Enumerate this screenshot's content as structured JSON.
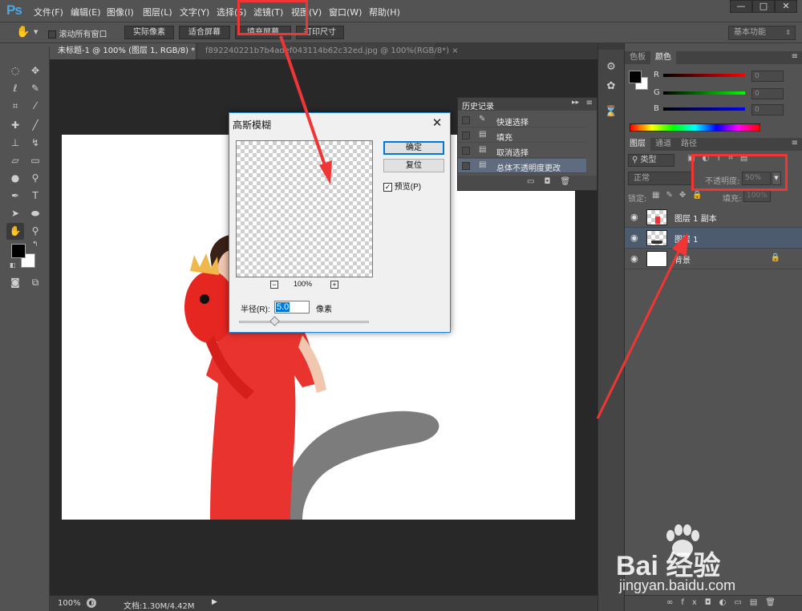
{
  "app": {
    "logo": "Ps"
  },
  "menu": [
    "文件(F)",
    "编辑(E)",
    "图像(I)",
    "图层(L)",
    "文字(Y)",
    "选择(S)",
    "滤镜(T)",
    "视图(V)",
    "窗口(W)",
    "帮助(H)"
  ],
  "window_controls": {
    "minimize": "—",
    "maximize": "□",
    "close": "✕"
  },
  "options_bar": {
    "scroll_all_label": "滚动所有窗口",
    "actual_pixels": "实际像素",
    "fit_screen": "适合屏幕",
    "fill_screen": "填充屏幕",
    "print_size": "打印尺寸",
    "workspace": "基本功能"
  },
  "tabs": [
    {
      "label": "未标题-1 @ 100% (图层 1, RGB/8) * ×"
    },
    {
      "label": "f892240221b7b4adef043114b62c32ed.jpg @ 100%(RGB/8*) ×"
    }
  ],
  "status": {
    "zoom": "100%",
    "doc_info": "文档:1.30M/4.42M"
  },
  "history_panel": {
    "title": "历史记录",
    "items": [
      {
        "label": "快速选择"
      },
      {
        "label": "填充"
      },
      {
        "label": "取消选择"
      },
      {
        "label": "总体不透明度更改"
      }
    ]
  },
  "color_panel": {
    "tabs": [
      "色板",
      "颜色"
    ],
    "channels": [
      {
        "label": "R",
        "value": "0"
      },
      {
        "label": "G",
        "value": "0"
      },
      {
        "label": "B",
        "value": "0"
      }
    ]
  },
  "layers_panel": {
    "tabs": [
      "图层",
      "通道",
      "路径"
    ],
    "filter_kind": "类型",
    "blend_mode": "正常",
    "opacity_label": "不透明度:",
    "opacity_value": "50%",
    "lock_label": "锁定:",
    "fill_label": "填充:",
    "fill_value": "100%",
    "layers": [
      {
        "name": "图层 1 副本"
      },
      {
        "name": "图层 1"
      },
      {
        "name": "背景"
      }
    ]
  },
  "dialog": {
    "title": "高斯模糊",
    "ok": "确定",
    "reset": "复位",
    "preview_label": "预览(P)",
    "zoom": "100%",
    "radius_label": "半径(R):",
    "radius_value": "5.0",
    "radius_unit": "像素",
    "radius_slider_fraction": 0.28
  },
  "watermark": {
    "brand": "Bai  经验",
    "url": "jingyan.baidu.com"
  },
  "colors": {
    "accent": "#f03535",
    "selection": "#4d5b6f",
    "dialog_border": "#1883d7"
  }
}
